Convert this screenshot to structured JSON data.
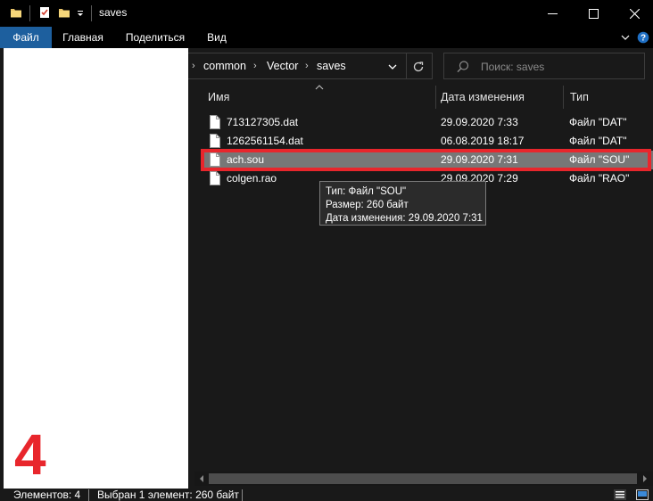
{
  "window": {
    "title": "saves",
    "minimize_glyph": "–",
    "maximize_glyph": "☐",
    "close_glyph": "✕"
  },
  "ribbon": {
    "tabs": [
      "Файл",
      "Главная",
      "Поделиться",
      "Вид"
    ]
  },
  "address": {
    "crumbs": [
      "common",
      "Vector",
      "saves"
    ]
  },
  "search": {
    "placeholder": "Поиск: saves"
  },
  "columns": {
    "name": "Имя",
    "date": "Дата изменения",
    "type": "Тип"
  },
  "files": [
    {
      "name": "713127305.dat",
      "date": "29.09.2020 7:33",
      "type": "Файл \"DAT\""
    },
    {
      "name": "1262561154.dat",
      "date": "06.08.2019 18:17",
      "type": "Файл \"DAT\""
    },
    {
      "name": "ach.sou",
      "date": "29.09.2020 7:31",
      "type": "Файл \"SOU\"",
      "selected": true
    },
    {
      "name": "colgen.rao",
      "date": "29.09.2020 7:29",
      "type": "Файл \"RAO\""
    }
  ],
  "tooltip": {
    "line1": "Тип: Файл \"SOU\"",
    "line2": "Размер: 260 байт",
    "line3": "Дата изменения: 29.09.2020 7:31"
  },
  "annotation": {
    "step_number": "4",
    "color": "#e8262c"
  },
  "status": {
    "items_count": "Элементов: 4",
    "selection": "Выбран 1 элемент: 260 байт"
  },
  "colors": {
    "background": "#191919",
    "selected_row": "#777777",
    "file_tab": "#1d5f9e"
  }
}
